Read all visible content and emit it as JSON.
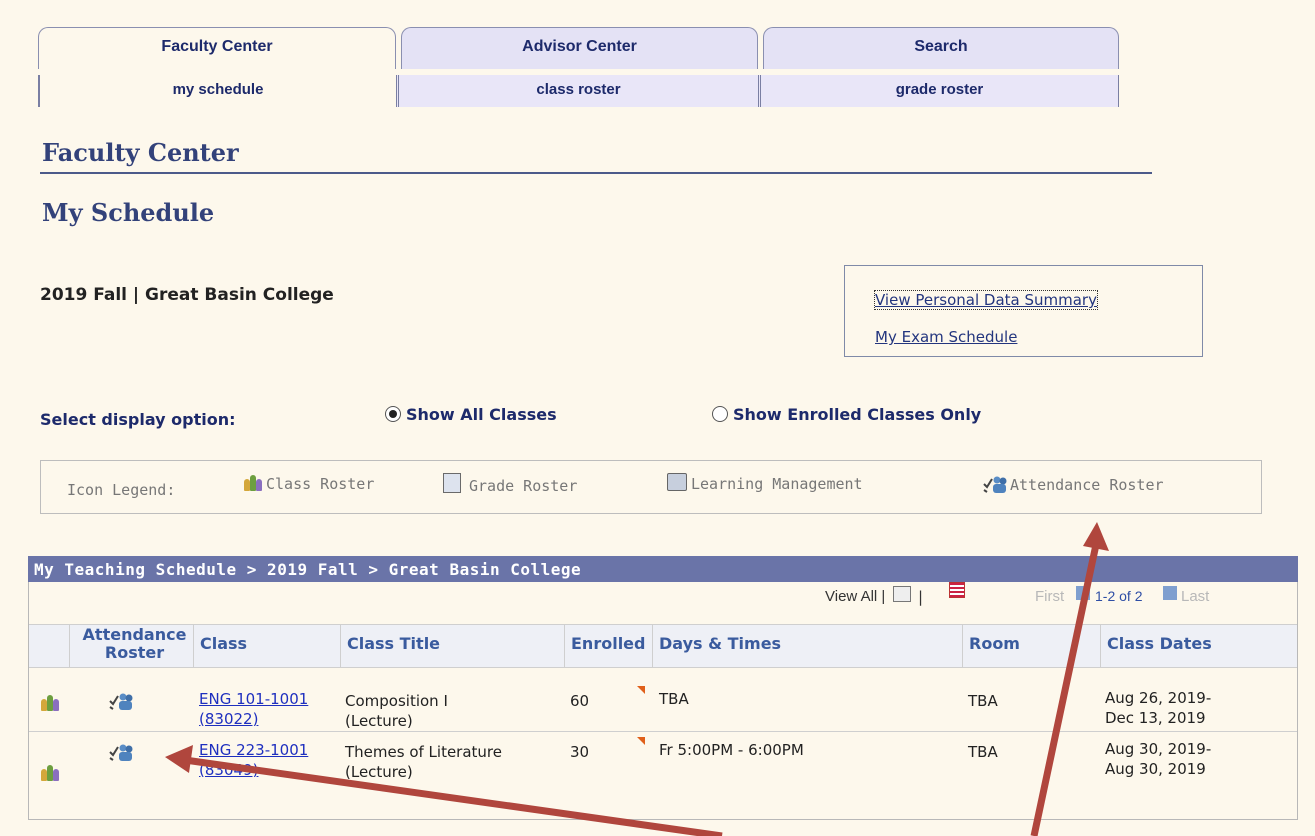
{
  "tabs": {
    "main": [
      "Faculty Center",
      "Advisor Center",
      "Search"
    ],
    "sub": [
      "my schedule",
      "class roster",
      "grade roster"
    ]
  },
  "page": {
    "heading": "Faculty Center",
    "subheading": "My Schedule",
    "term": "2019 Fall | Great Basin College"
  },
  "links": {
    "personal_data": "View Personal Data Summary",
    "exam_schedule": "My Exam Schedule"
  },
  "display_options": {
    "label": "Select display option:",
    "show_all": "Show All Classes",
    "show_enrolled": "Show Enrolled Classes Only",
    "selected": "Show All Classes"
  },
  "legend": {
    "label": "Icon Legend:",
    "class_roster": "Class Roster",
    "grade_roster": "Grade Roster",
    "learning_mgmt": "Learning Management",
    "attendance_roster": "Attendance Roster"
  },
  "grid": {
    "title": "My Teaching Schedule > 2019 Fall > Great Basin College",
    "view_all": "View All",
    "nav_first": "First",
    "nav_range": "1-2 of 2",
    "nav_last": "Last",
    "columns": {
      "attendance_line1": "Attendance",
      "attendance_line2": "Roster",
      "class": "Class",
      "class_title": "Class Title",
      "enrolled": "Enrolled",
      "days_times": "Days & Times",
      "room": "Room",
      "class_dates": "Class Dates"
    },
    "rows": [
      {
        "class_line1": "ENG 101-1001",
        "class_line2": "(83022)",
        "title_line1": "Composition I",
        "title_line2": "(Lecture)",
        "enrolled": "60",
        "days_times": "TBA",
        "room": "TBA",
        "dates_line1": "Aug 26, 2019-",
        "dates_line2": "Dec 13, 2019"
      },
      {
        "class_line1": "ENG 223-1001",
        "class_line2": "(83049)",
        "title_line1": "Themes of Literature",
        "title_line2": "(Lecture)",
        "enrolled": "30",
        "days_times": "Fr 5:00PM - 6:00PM",
        "room": "TBA",
        "dates_line1": "Aug 30, 2019-",
        "dates_line2": "Aug 30, 2019"
      }
    ]
  },
  "colors": {
    "background": "#fdf8ec",
    "header_bar": "#6a74a8",
    "heading_text": "#33427a",
    "arrow": "#b0463d",
    "link": "#1e2fbf"
  }
}
